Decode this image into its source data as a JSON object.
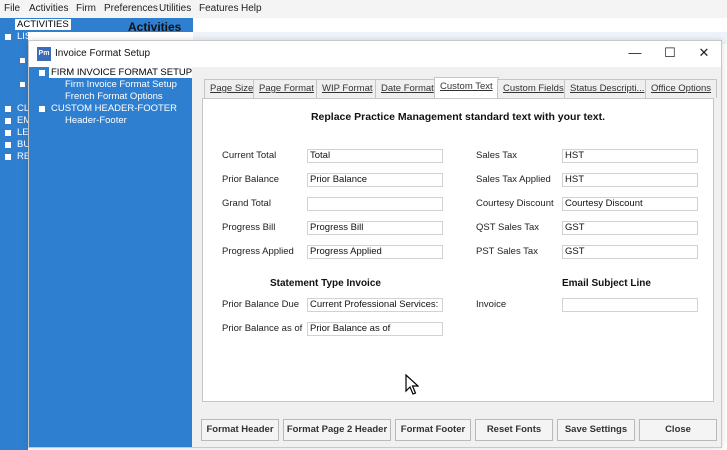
{
  "menubar": [
    "File",
    "Activities",
    "Firm",
    "Preferences",
    "Utilities",
    "Features",
    "Help"
  ],
  "left_tree": {
    "activities": "ACTIVITIES",
    "lists": "LISTS",
    "items": [
      "CL",
      "EM",
      "LE",
      "BU",
      "RE"
    ]
  },
  "activities_title": "Activities",
  "dialog": {
    "title": "Invoice Format Setup",
    "icon_text": "Pm",
    "controls": {
      "minimize": "—",
      "maximize": "☐",
      "close": "✕"
    }
  },
  "tree": {
    "firm_setup": "FIRM INVOICE FORMAT SETUP",
    "firm_format_setup": "Firm Invoice Format Setup",
    "french_options": "French Format Options",
    "custom_header_footer": "CUSTOM HEADER-FOOTER",
    "header_footer": "Header-Footer"
  },
  "tabs": [
    "Page Size",
    "Page Format",
    "WIP Format",
    "Date Format",
    "Custom Text",
    "Custom Fields",
    "Status Descripti...",
    "Office Options"
  ],
  "active_tab": "Custom Text",
  "panel": {
    "heading": "Replace Practice Management standard text with your text.",
    "left_fields": [
      {
        "label": "Current Total",
        "value": "Total"
      },
      {
        "label": "Prior Balance",
        "value": "Prior Balance"
      },
      {
        "label": "Grand Total",
        "value": ""
      },
      {
        "label": "Progress Bill",
        "value": "Progress Bill"
      },
      {
        "label": "Progress Applied",
        "value": "Progress Applied"
      }
    ],
    "right_fields": [
      {
        "label": "Sales Tax",
        "value": "HST"
      },
      {
        "label": "Sales Tax Applied",
        "value": "HST"
      },
      {
        "label": "Courtesy Discount",
        "value": "Courtesy Discount"
      },
      {
        "label": "QST Sales Tax",
        "value": "GST"
      },
      {
        "label": "PST Sales Tax",
        "value": "GST"
      }
    ],
    "statement_heading": "Statement Type Invoice",
    "statement_fields": [
      {
        "label": "Prior Balance Due",
        "value": "Current Professional Services:"
      },
      {
        "label": "Prior Balance as of",
        "value": "Prior Balance as of"
      }
    ],
    "email_heading": "Email Subject Line",
    "email_fields": [
      {
        "label": "Invoice",
        "value": ""
      }
    ]
  },
  "buttons": {
    "format_header": "Format Header",
    "format_page2_header": "Format Page 2 Header",
    "format_footer": "Format Footer",
    "reset_fonts": "Reset Fonts",
    "save_settings": "Save Settings",
    "close": "Close"
  }
}
